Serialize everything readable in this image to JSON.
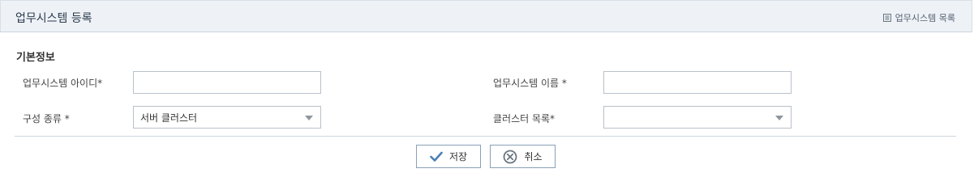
{
  "header": {
    "title": "업무시스템 등록",
    "list_link": "업무시스템 목록"
  },
  "section": {
    "title": "기본정보"
  },
  "form": {
    "system_id": {
      "label": "업무시스템 아이디*",
      "value": ""
    },
    "system_name": {
      "label": "업무시스템 이름 *",
      "value": ""
    },
    "config_type": {
      "label": "구성 종류 *",
      "selected": "서버 클러스터"
    },
    "cluster_list": {
      "label": "클러스터 목록*",
      "selected": ""
    }
  },
  "actions": {
    "save_label": "저장",
    "cancel_label": "취소"
  },
  "colors": {
    "header_bg": "#eef2f7",
    "check_icon": "#4a7fb5",
    "cancel_icon": "#6b7680"
  }
}
